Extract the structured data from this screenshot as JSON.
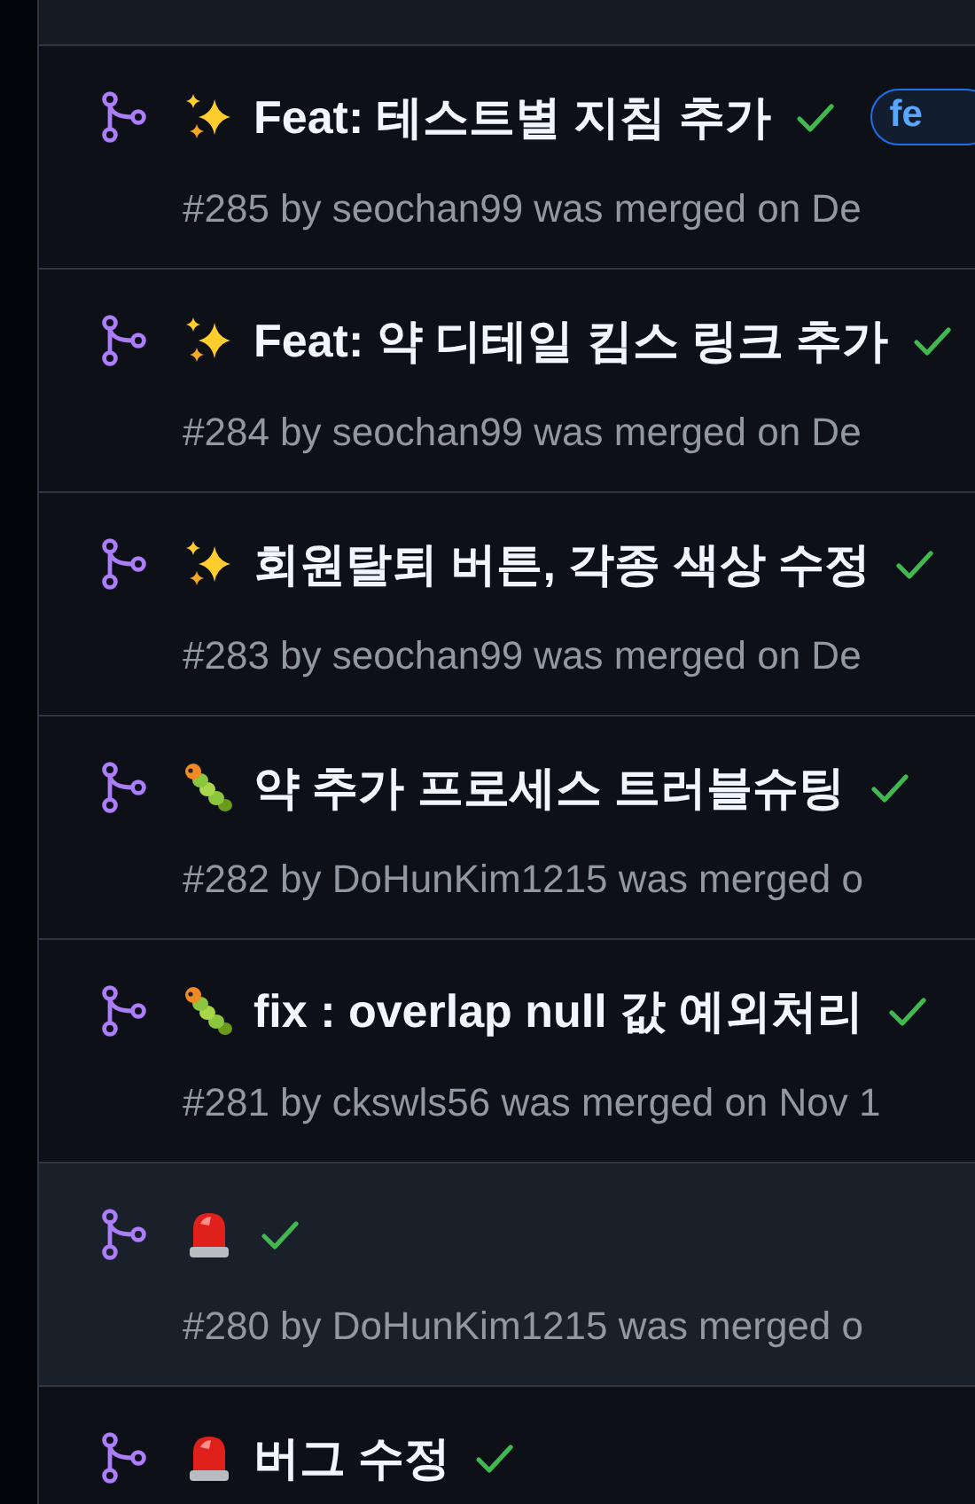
{
  "pull_requests": [
    {
      "kind": "sparkles",
      "title": "Feat: 테스트별 지침 추가",
      "checks_passed": true,
      "labels": [
        {
          "name": "fe"
        }
      ],
      "meta": "#285 by seochan99 was merged on De",
      "highlighted": false
    },
    {
      "kind": "sparkles",
      "title": "Feat: 약 디테일 킴스 링크 추가",
      "checks_passed": true,
      "meta": "#284 by seochan99 was merged on De",
      "highlighted": false
    },
    {
      "kind": "sparkles",
      "title": "회원탈퇴 버튼, 각종 색상 수정",
      "checks_passed": true,
      "meta": "#283 by seochan99 was merged on De",
      "highlighted": false
    },
    {
      "kind": "bug",
      "title": "약 추가 프로세스 트러블슈팅",
      "checks_passed": true,
      "meta": "#282 by DoHunKim1215 was merged o",
      "highlighted": false
    },
    {
      "kind": "bug",
      "title": "fix : overlap null 값 예외처리",
      "checks_passed": true,
      "meta": "#281 by ckswls56 was merged on Nov 1",
      "highlighted": false
    },
    {
      "kind": "siren",
      "checks_passed": true,
      "meta": "#280 by DoHunKim1215 was merged o",
      "highlighted": true
    },
    {
      "kind": "siren",
      "title": "버그 수정",
      "checks_passed": true,
      "highlighted": false
    }
  ]
}
